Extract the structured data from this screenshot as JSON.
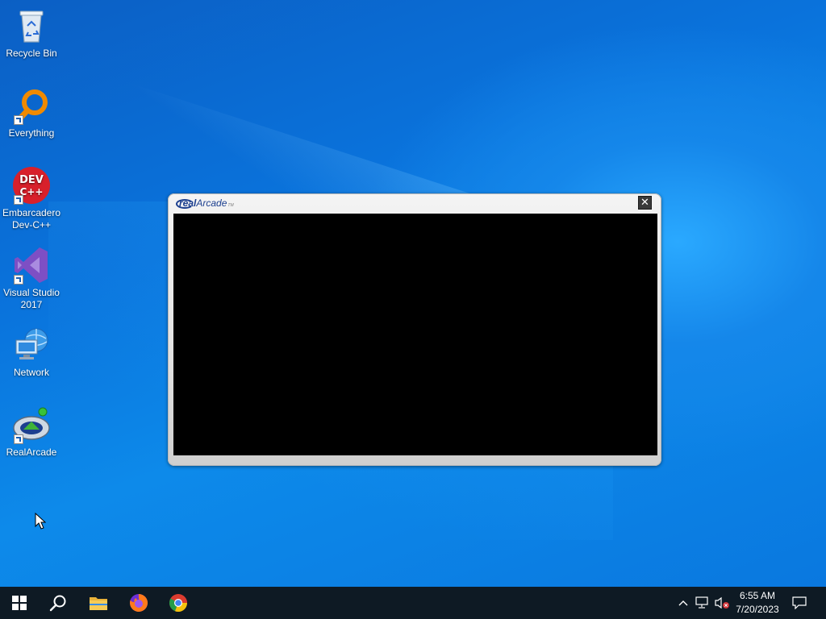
{
  "desktop": {
    "icons": [
      {
        "label_line1": "Recycle Bin",
        "label_line2": ""
      },
      {
        "label_line1": "Everything",
        "label_line2": ""
      },
      {
        "label_line1": "Embarcadero",
        "label_line2": "Dev-C++"
      },
      {
        "label_line1": "Visual Studio",
        "label_line2": "2017"
      },
      {
        "label_line1": "Network",
        "label_line2": ""
      },
      {
        "label_line1": "RealArcade",
        "label_line2": ""
      }
    ]
  },
  "dialog": {
    "logo_bold": "real",
    "logo_rest": "Arcade",
    "logo_tm": "TM",
    "close_glyph": "✕"
  },
  "taskbar": {
    "time": "6:55 AM",
    "date": "7/20/2023"
  },
  "colors": {
    "taskbar": "#0e1a24",
    "desktop_blue": "#0a73dc",
    "game_area": "#000000"
  },
  "icons": [
    "recycle-bin-icon",
    "everything-icon",
    "devcpp-icon",
    "visual-studio-icon",
    "network-icon",
    "realarcade-icon",
    "windows-start-icon",
    "search-icon",
    "file-explorer-icon",
    "firefox-icon",
    "chrome-icon",
    "chevron-up-icon",
    "network-tray-icon",
    "volume-muted-icon",
    "notification-icon"
  ]
}
